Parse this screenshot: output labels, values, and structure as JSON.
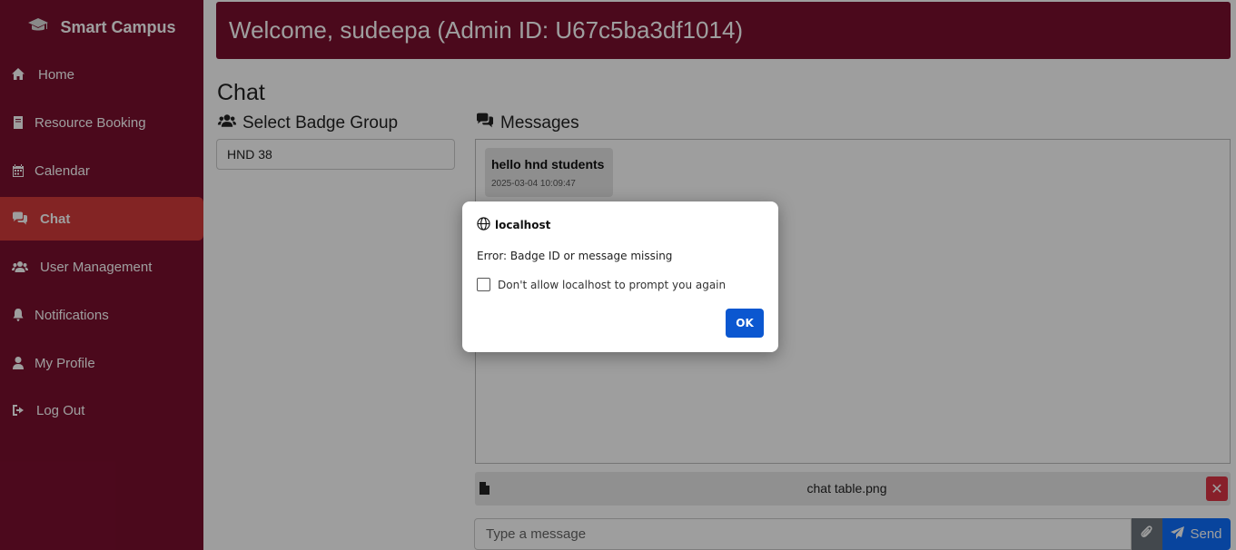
{
  "sidebar": {
    "brand": "Smart Campus",
    "items": [
      {
        "label": "Home",
        "icon": "home-icon"
      },
      {
        "label": "Resource Booking",
        "icon": "book-icon"
      },
      {
        "label": "Calendar",
        "icon": "calendar-icon"
      },
      {
        "label": "Chat",
        "icon": "chat-icon",
        "active": true
      },
      {
        "label": "User Management",
        "icon": "users-icon"
      },
      {
        "label": "Notifications",
        "icon": "bell-icon"
      },
      {
        "label": "My Profile",
        "icon": "user-icon"
      },
      {
        "label": "Log Out",
        "icon": "logout-icon"
      }
    ]
  },
  "header": {
    "welcome": "Welcome, sudeepa (Admin ID: U67c5ba3df1014)"
  },
  "chat": {
    "title": "Chat",
    "badge_section_title": "Select Badge Group",
    "badge_selected": "HND 38",
    "messages_title": "Messages",
    "messages": [
      {
        "text": "hello hnd students",
        "time": "2025-03-04 10:09:47"
      }
    ],
    "attachment": {
      "name": "chat table.png",
      "remove_label": "✕"
    },
    "input_placeholder": "Type a message",
    "send_label": "Send"
  },
  "dialog": {
    "origin": "localhost",
    "message": "Error: Badge ID or message missing",
    "checkbox_label": "Don't allow localhost to prompt you again",
    "ok_label": "OK"
  },
  "colors": {
    "sidebar": "#7a0f2e",
    "active_item": "#d43a3a",
    "primary": "#0d6efd",
    "danger": "#dc3545"
  }
}
